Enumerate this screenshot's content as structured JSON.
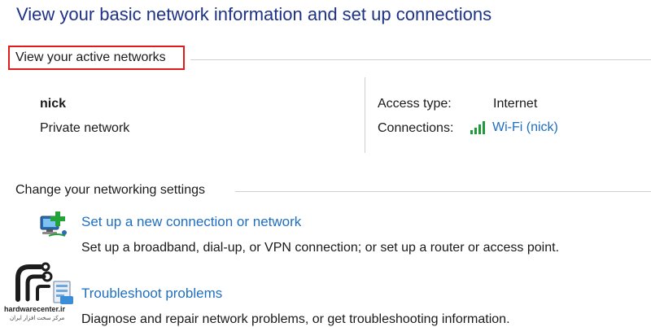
{
  "page": {
    "title": "View your basic network information and set up connections"
  },
  "active_networks": {
    "header": "View your active networks",
    "network_name": "nick",
    "network_type": "Private network",
    "access_type_label": "Access type:",
    "access_type_value": "Internet",
    "connections_label": "Connections:",
    "connection_link": "Wi-Fi (nick)",
    "signal_icon": "wifi-signal-icon"
  },
  "change_settings": {
    "header": "Change your networking settings",
    "items": [
      {
        "icon": "new-connection-icon",
        "link": "Set up a new connection or network",
        "description": "Set up a broadband, dial-up, or VPN connection; or set up a router or access point."
      },
      {
        "icon": "troubleshoot-icon",
        "link": "Troubleshoot problems",
        "description": "Diagnose and repair network problems, or get troubleshooting information."
      }
    ]
  },
  "watermark": {
    "site": "hardwarecenter.ir",
    "tagline": "مرکز سخت افزار ایران"
  },
  "colors": {
    "title": "#1e3287",
    "link": "#1e6fc0",
    "highlight": "#e01b1b",
    "rule": "#cfcfcf"
  }
}
